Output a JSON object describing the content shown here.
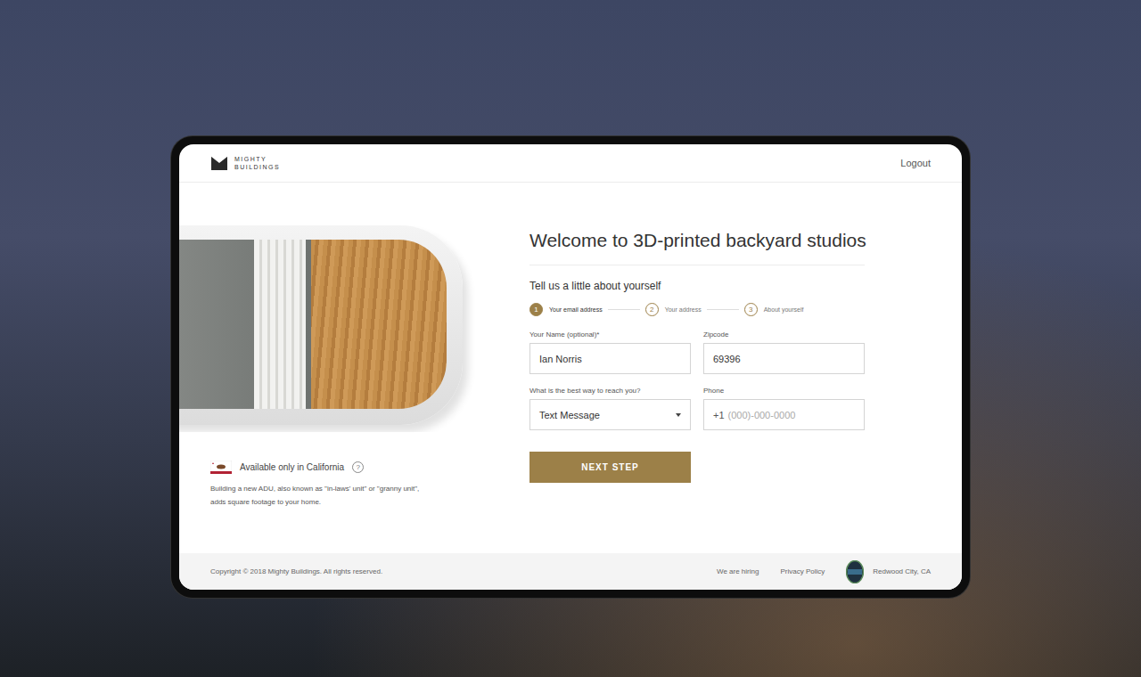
{
  "header": {
    "logo": [
      "MIGHTY",
      "BUILDINGS"
    ],
    "logout": "Logout"
  },
  "left": {
    "availability": "Available only in California",
    "help": "?",
    "description": "Building a new ADU, also known as \"in-laws' unit\" or \"granny unit\", adds square footage to your home."
  },
  "form": {
    "title": "Welcome to 3D-printed backyard studios",
    "subtitle": "Tell us a little about yourself",
    "steps": [
      {
        "number": "1",
        "label": "Your email address",
        "selected": true
      },
      {
        "number": "2",
        "label": "Your address",
        "selected": false
      },
      {
        "number": "3",
        "label": "About yourself",
        "selected": false
      }
    ],
    "fields": [
      {
        "label": "Your Name (optional)*",
        "value": "Ian Norris",
        "prefix": "",
        "placeholder": "",
        "kind": "text"
      },
      {
        "label": "Zipcode",
        "value": "69396",
        "prefix": "",
        "placeholder": "",
        "kind": "text"
      },
      {
        "label": "What is the best way to reach you?",
        "value": "Text Message",
        "prefix": "",
        "placeholder": "",
        "kind": "select"
      },
      {
        "label": "Phone",
        "value": "",
        "prefix": "+1",
        "placeholder": "(000)-000-0000",
        "kind": "phone"
      }
    ],
    "button": "NEXT STEP"
  },
  "footer": {
    "copyright": "Copyright © 2018 Mighty Buildings. All rights reserved.",
    "links": [
      "We are hiring",
      "Privacy Policy"
    ],
    "location": "Redwood City, CA"
  }
}
